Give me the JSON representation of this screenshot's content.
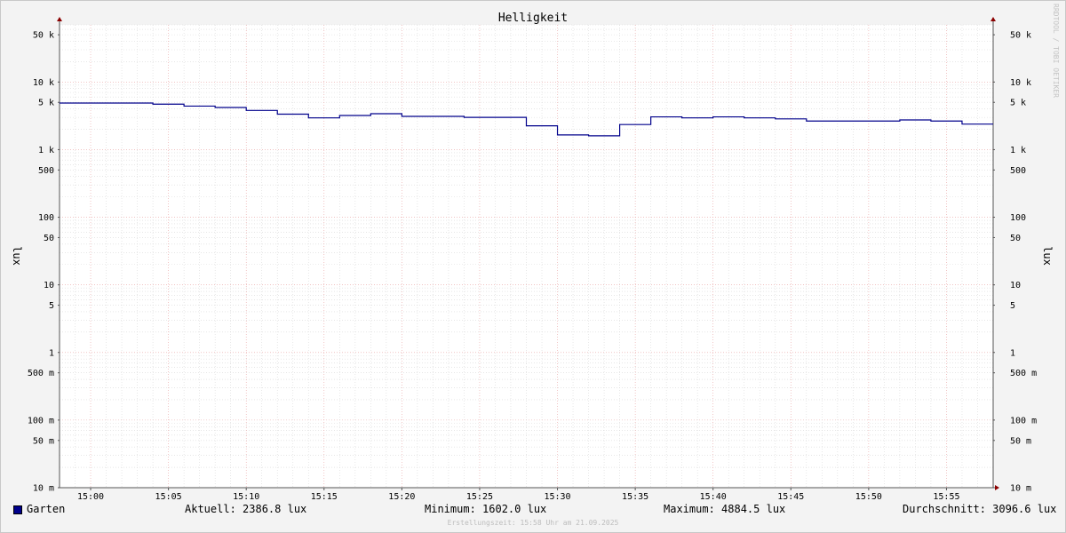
{
  "watermark": "RRDTOOL / TOBI OETIKER",
  "footer": "Erstellungszeit: 15:58 Uhr am 21.09.2025",
  "legend": {
    "series_name": "Garten",
    "aktuell": "Aktuell: 2386.8 lux",
    "minimum": "Minimum: 1602.0 lux",
    "maximum": "Maximum: 4884.5 lux",
    "durchschnitt": "Durchschnitt: 3096.6 lux"
  },
  "chart_data": {
    "type": "line",
    "title": "Helligkeit",
    "ylabel": "lux",
    "ylabel_right": "lux",
    "y_scale": "log",
    "ylim": [
      0.01,
      70000
    ],
    "xlim": [
      "14:58",
      "15:58"
    ],
    "x_ticks": [
      "15:00",
      "15:05",
      "15:10",
      "15:15",
      "15:20",
      "15:25",
      "15:30",
      "15:35",
      "15:40",
      "15:45",
      "15:50",
      "15:55"
    ],
    "y_ticks": [
      {
        "value": 50000,
        "label": "50 k"
      },
      {
        "value": 10000,
        "label": "10 k"
      },
      {
        "value": 5000,
        "label": "5 k"
      },
      {
        "value": 1000,
        "label": "1 k"
      },
      {
        "value": 500,
        "label": "500"
      },
      {
        "value": 100,
        "label": "100"
      },
      {
        "value": 50,
        "label": "50"
      },
      {
        "value": 10,
        "label": "10"
      },
      {
        "value": 5,
        "label": "5"
      },
      {
        "value": 1,
        "label": "1"
      },
      {
        "value": 0.5,
        "label": "500 m"
      },
      {
        "value": 0.1,
        "label": "100 m"
      },
      {
        "value": 0.05,
        "label": "50 m"
      },
      {
        "value": 0.01,
        "label": "10 m"
      }
    ],
    "grid": true,
    "colors": {
      "line": "#00008b",
      "minor_grid": "#d8d8d8",
      "major_grid": "#e8a0a0",
      "axis": "#555555",
      "arrow": "#8b0000"
    },
    "series": [
      {
        "name": "Garten",
        "step": true,
        "x": [
          "14:58",
          "15:04",
          "15:06",
          "15:08",
          "15:10",
          "15:12",
          "15:14",
          "15:16",
          "15:18",
          "15:20",
          "15:22",
          "15:24",
          "15:26",
          "15:28",
          "15:30",
          "15:32",
          "15:34",
          "15:36",
          "15:38",
          "15:40",
          "15:42",
          "15:44",
          "15:46",
          "15:48",
          "15:50",
          "15:52",
          "15:54",
          "15:56",
          "15:58"
        ],
        "y": [
          4884.5,
          4700,
          4400,
          4200,
          3800,
          3350,
          2950,
          3200,
          3400,
          3100,
          3100,
          3000,
          3000,
          2250,
          1650,
          1602,
          2350,
          3050,
          2950,
          3050,
          2950,
          2850,
          2650,
          2650,
          2650,
          2750,
          2650,
          2386.8,
          2386.8
        ]
      }
    ]
  }
}
